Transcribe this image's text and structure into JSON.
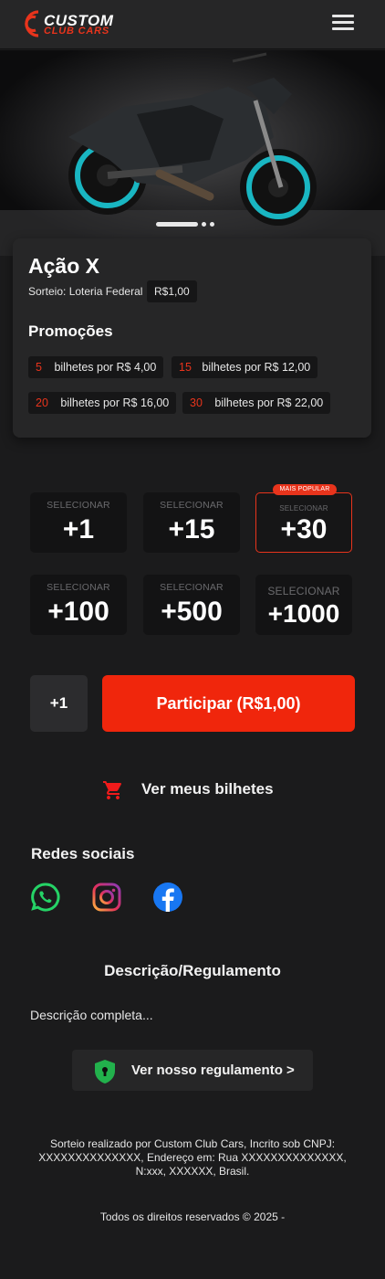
{
  "header": {
    "logo_line1": "CUSTOM",
    "logo_line2": "CLUB CARS",
    "menu_icon": "hamburger-menu-icon"
  },
  "hero": {
    "image_subject": "dark naked motorcycle with teal wheels",
    "slides": 3,
    "active_slide": 1
  },
  "raffle": {
    "title": "Ação X",
    "sorteio": "Sorteio: Loteria Federal",
    "price": "R$1,00",
    "promotions_title": "Promoções",
    "promotions": [
      {
        "qty": "5",
        "text": "bilhetes por R$ 4,00"
      },
      {
        "qty": "15",
        "text": "bilhetes por R$ 12,00"
      },
      {
        "qty": "20",
        "text": "bilhetes por R$ 16,00"
      },
      {
        "qty": "30",
        "text": "bilhetes por R$ 22,00"
      }
    ]
  },
  "selector": {
    "label": "SELECIONAR",
    "popular_tag": "MAIS POPULAR",
    "options": [
      "+1",
      "+15",
      "+30",
      "+100",
      "+500",
      "+1000"
    ]
  },
  "purchase": {
    "quantity": "+1",
    "button": "Participar (R$1,00)"
  },
  "tickets_link": {
    "label": "Ver meus bilhetes",
    "icon": "cart-icon"
  },
  "social": {
    "title": "Redes sociais",
    "networks": [
      "whatsapp-icon",
      "instagram-icon",
      "facebook-icon"
    ]
  },
  "description": {
    "title": "Descrição/Regulamento",
    "text": "Descrição completa...",
    "rules_button": "Ver nosso regulamento >"
  },
  "footer": {
    "text": "Sorteio realizado por Custom Club Cars, Incrito sob CNPJ: XXXXXXXXXXXXXX, Endereço em: Rua XXXXXXXXXXXXXX, N:xxx, XXXXXX, Brasil.",
    "copyright": "Todos os direitos reservados © 2025 -"
  },
  "colors": {
    "background": "#1b1b1c",
    "card": "#262627",
    "accent": "#f0260c",
    "promo_number": "#e8341c",
    "whatsapp": "#25d366",
    "facebook": "#1877f2",
    "shield": "#22b14c"
  }
}
